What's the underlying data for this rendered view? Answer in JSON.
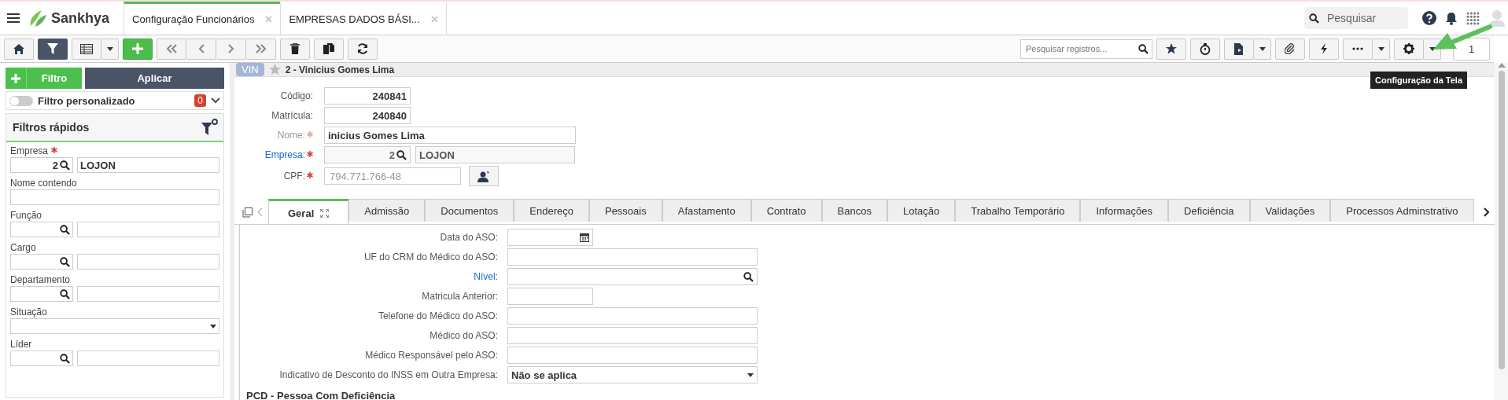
{
  "header": {
    "app_name": "Sankhya",
    "tabs": [
      {
        "label": "Configuração Funcionários",
        "selected": true
      },
      {
        "label": "EMPRESAS DADOS BÁSI...",
        "selected": false
      }
    ],
    "search": {
      "placeholder": "Pesquisar"
    }
  },
  "toolbar": {
    "filter_on": true,
    "search": {
      "placeholder": "Pesquisar registros..."
    },
    "page": "1",
    "tooltip": "Configuração da Tela"
  },
  "filter_panel": {
    "add_label": "Filtro",
    "apply_label": "Aplicar",
    "custom_filter": {
      "label": "Filtro personalizado",
      "on": false,
      "count": "0"
    },
    "quick_filters_title": "Filtros rápidos",
    "fields": [
      {
        "label": "Empresa",
        "required": true,
        "kind": "lookup",
        "code": "2",
        "description": "LOJON"
      },
      {
        "label": "Nome contendo",
        "required": false,
        "kind": "text"
      },
      {
        "label": "Função",
        "required": false,
        "kind": "lookup"
      },
      {
        "label": "Cargo",
        "required": false,
        "kind": "lookup"
      },
      {
        "label": "Departamento",
        "required": false,
        "kind": "lookup"
      },
      {
        "label": "Situação",
        "required": false,
        "kind": "select"
      },
      {
        "label": "Líder",
        "required": false,
        "kind": "lookup"
      }
    ]
  },
  "record": {
    "badge": "VIN",
    "title": "2 - Vinicius Gomes Lima",
    "favorite": false,
    "fields": [
      {
        "label": "Código:",
        "required": false,
        "link": false,
        "label_faded": false,
        "kind": "short",
        "value": "240841"
      },
      {
        "label": "Matrícula:",
        "required": false,
        "link": false,
        "label_faded": false,
        "kind": "short",
        "value": "240840"
      },
      {
        "label": "Nome:",
        "required": true,
        "link": false,
        "label_faded": true,
        "kind": "long",
        "value": "inicius Gomes Lima"
      },
      {
        "label": "Empresa:",
        "required": true,
        "link": true,
        "label_faded": false,
        "kind": "lookup",
        "code": "2",
        "value": "LOJON"
      },
      {
        "label": "CPF:",
        "required": true,
        "link": false,
        "label_faded": false,
        "kind": "cpf",
        "placeholder": "794.771.766-48"
      }
    ]
  },
  "detail_tabs": [
    {
      "label": "Geral",
      "selected": true
    },
    {
      "label": "Admissão",
      "selected": false
    },
    {
      "label": "Documentos",
      "selected": false
    },
    {
      "label": "Endereço",
      "selected": false
    },
    {
      "label": "Pessoais",
      "selected": false
    },
    {
      "label": "Afastamento",
      "selected": false
    },
    {
      "label": "Contrato",
      "selected": false
    },
    {
      "label": "Bancos",
      "selected": false
    },
    {
      "label": "Lotação",
      "selected": false
    },
    {
      "label": "Trabalho Temporário",
      "selected": false
    },
    {
      "label": "Informações",
      "selected": false
    },
    {
      "label": "Deficiência",
      "selected": false
    },
    {
      "label": "Validações",
      "selected": false
    },
    {
      "label": "Processos Adminstrativo",
      "selected": false
    }
  ],
  "detail_fields": [
    {
      "label": "Data do ASO:",
      "link": false,
      "kind": "date"
    },
    {
      "label": "UF do CRM do Médico do ASO:",
      "link": false,
      "kind": "text"
    },
    {
      "label": "Nível:",
      "link": true,
      "kind": "lookup"
    },
    {
      "label": "Matricula Anterior:",
      "link": false,
      "kind": "short"
    },
    {
      "label": "Telefone do Médico do ASO:",
      "link": false,
      "kind": "text"
    },
    {
      "label": "Médico do ASO:",
      "link": false,
      "kind": "text"
    },
    {
      "label": "Médico Responsável pelo ASO:",
      "link": false,
      "kind": "text"
    },
    {
      "label": "Indicativo de Desconto do INSS em Outra Empresa:",
      "link": false,
      "kind": "select",
      "value": "Não se aplica"
    }
  ],
  "section_title": "PCD - Pessoa Com Deficiência"
}
